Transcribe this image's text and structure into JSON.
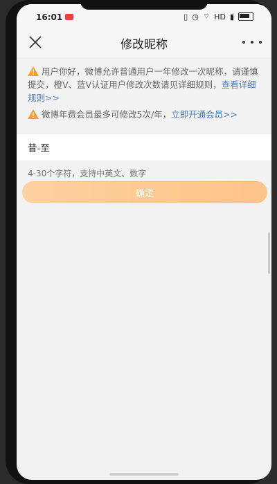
{
  "status_bar": {
    "time": "16:01",
    "network": "HD",
    "signal_icons": [
      "vibrate-icon",
      "alarm-icon",
      "wifi-icon",
      "signal-icon",
      "battery-icon"
    ]
  },
  "nav": {
    "title": "修改昵称",
    "close_icon": "close-icon",
    "more_icon": "more-icon"
  },
  "notices": {
    "first_text": "用户你好，微博允许普通用户一年修改一次昵称，请谨慎提交，橙V、蓝V认证用户修改次数请见详细规则，",
    "first_link": "查看详细规则>>",
    "second_text": "微博年费会员最多可修改5次/年，",
    "second_link": "立即开通会员>>"
  },
  "nickname": {
    "value": "昔-至",
    "hint": "4-30个字符，支持中英文、数字"
  },
  "confirm_label": "确定",
  "colors": {
    "warning": "#f0a030",
    "link": "#4f7bb5",
    "button_start": "#fdd1a0",
    "button_end": "#fbc488",
    "background": "#f2f2f2"
  }
}
